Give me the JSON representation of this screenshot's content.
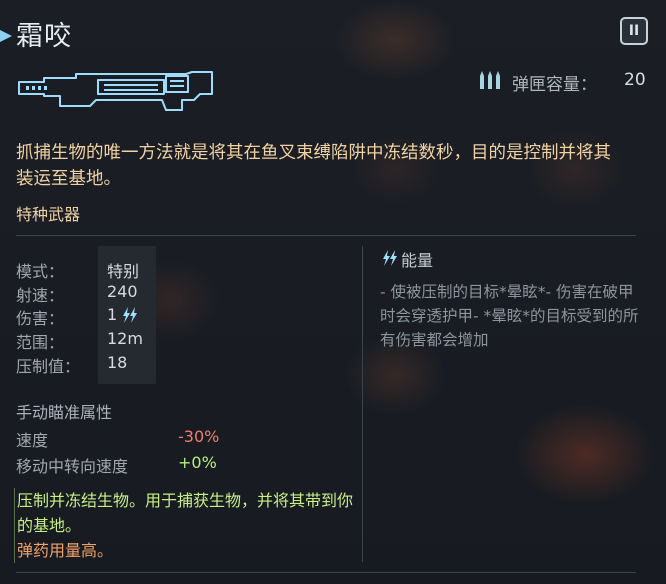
{
  "title": "霜咬",
  "tier": "II",
  "magazine": {
    "label": "弹匣容量：",
    "value": "20"
  },
  "description": "抓捕生物的唯一方法就是将其在鱼叉束缚陷阱中冻结数秒，目的是控制并将其装运至基地。",
  "category": "特种武器",
  "stats": [
    {
      "label": "模式：",
      "value": "特别"
    },
    {
      "label": "射速：",
      "value": "240"
    },
    {
      "label": "伤害：",
      "value": "1"
    },
    {
      "label": "范围：",
      "value": "12m"
    },
    {
      "label": "压制值：",
      "value": "18"
    }
  ],
  "energy": {
    "title": "能量",
    "description": "- 使被压制的目标*晕眩*- 伤害在破甲时会穿透护甲- *晕眩*的目标受到的所有伤害都会增加"
  },
  "aim": {
    "title": "手动瞄准属性",
    "rows": [
      {
        "label": "速度",
        "value": "-30%",
        "tone": "negative"
      },
      {
        "label": "移动中转向速度",
        "value": "+0%",
        "tone": "positive"
      }
    ]
  },
  "notes": {
    "positive": "压制并冻结生物。用于捕获生物，并将其带到你的基地。",
    "negative": "弹药用量高。"
  },
  "colors": {
    "accent": "#8fd0f5",
    "desc": "#f0d2a4",
    "positive": "#b6ee7f",
    "negative": "#ee7d6c",
    "warning": "#f0a167"
  },
  "icons": {
    "tier": "roman-numeral-badge-icon",
    "weapon": "weapon-silhouette-icon",
    "magazine": "ammo-clip-icon",
    "damage": "lightning-icon",
    "energy": "lightning-icon"
  }
}
